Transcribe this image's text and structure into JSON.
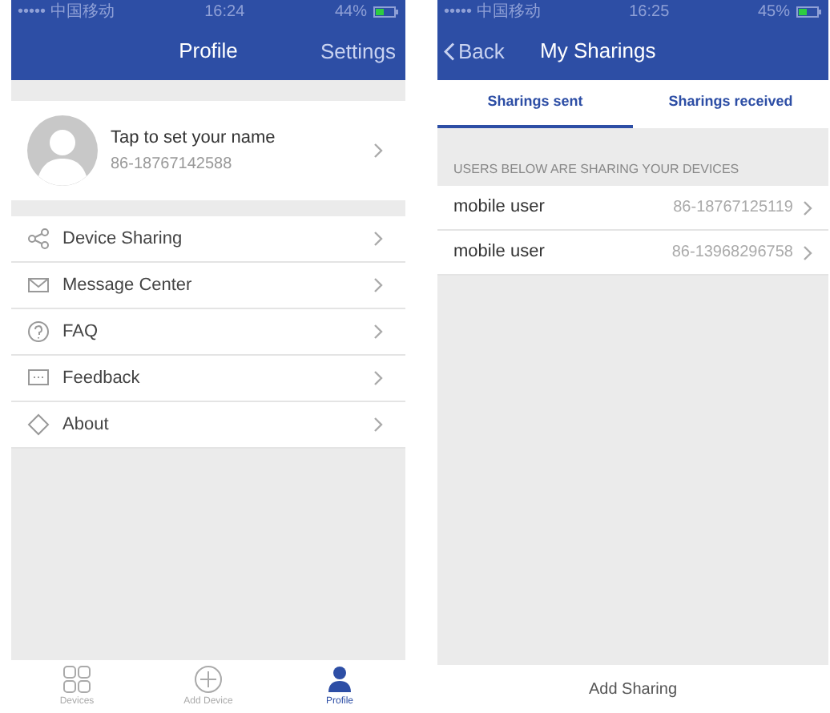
{
  "profile_screen": {
    "status_bar": {
      "carrier": "••••• 中国移动",
      "time": "16:24",
      "battery": "44%"
    },
    "title": "Profile",
    "settings": "Settings",
    "user": {
      "name": "Tap to set your name",
      "phone": "86-18767142588"
    },
    "menu": [
      {
        "label": "Device Sharing"
      },
      {
        "label": "Message Center"
      },
      {
        "label": "FAQ"
      },
      {
        "label": "Feedback"
      },
      {
        "label": "About"
      }
    ],
    "tab_bar": [
      {
        "label": "Devices",
        "selected": false
      },
      {
        "label": "Add Device",
        "selected": false
      },
      {
        "label": "Profile",
        "selected": true
      }
    ]
  },
  "sharings_screen": {
    "status_bar": {
      "carrier": "••••• 中国移动",
      "time": "16:25",
      "battery": "45%"
    },
    "back": "Back",
    "title": "My Sharings",
    "tabs": [
      {
        "label": "Sharings sent",
        "selected": true
      },
      {
        "label": "Sharings received",
        "selected": false
      }
    ],
    "section_header": "USERS BELOW ARE SHARING YOUR DEVICES",
    "users": [
      {
        "name": "mobile user",
        "phone": "86-18767125119"
      },
      {
        "name": "mobile user",
        "phone": "86-13968296758"
      }
    ],
    "add_button": "Add Sharing"
  }
}
